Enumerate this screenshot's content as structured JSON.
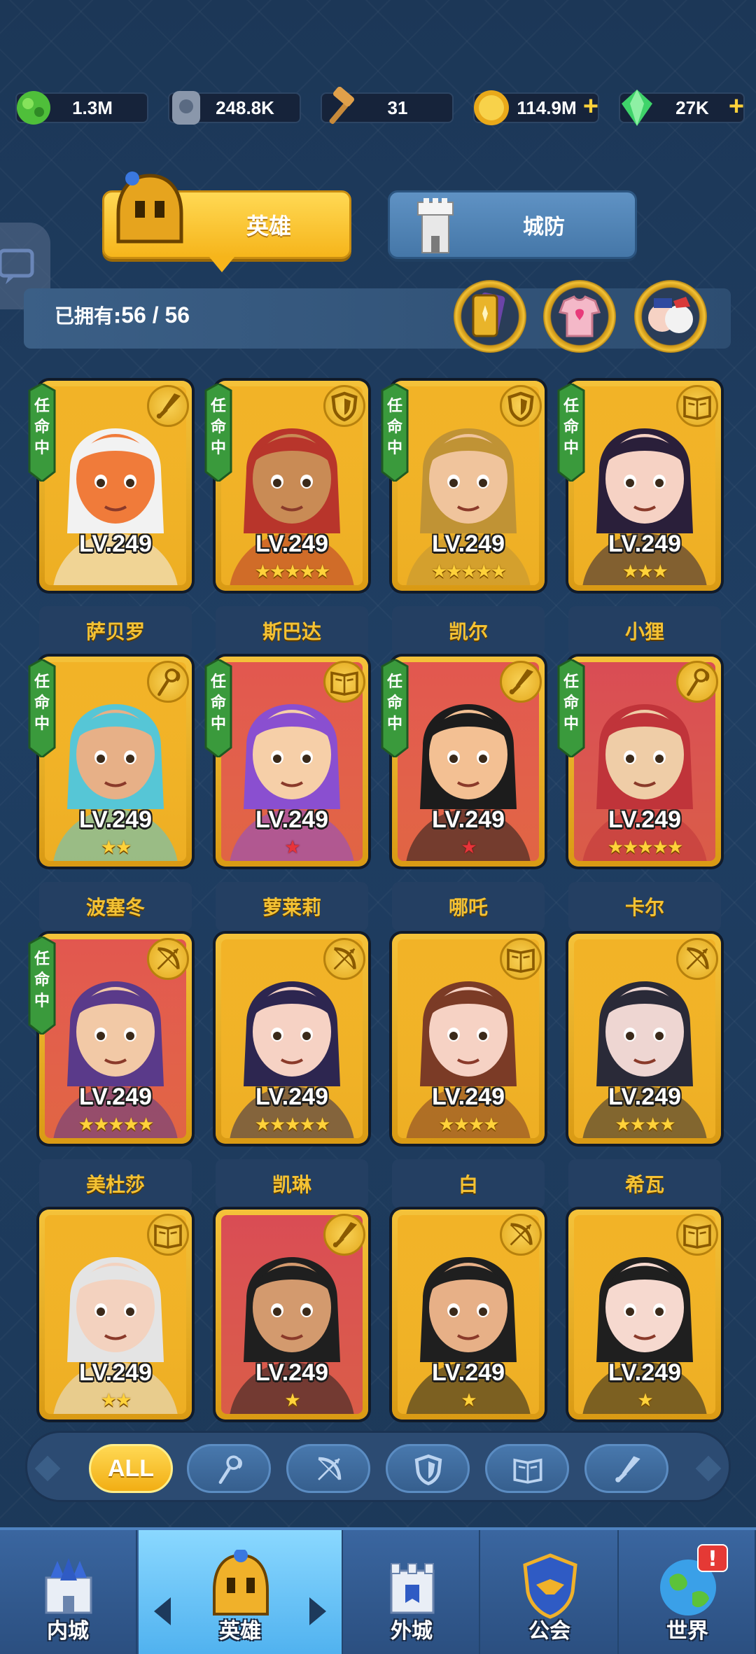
{
  "resources": [
    {
      "name": "food",
      "icon": "green-ore-icon",
      "value": "1.3M",
      "plus": false
    },
    {
      "name": "stone",
      "icon": "stone-icon",
      "value": "248.8K",
      "plus": false
    },
    {
      "name": "hammer",
      "icon": "hammer-icon",
      "value": "31",
      "plus": false
    },
    {
      "name": "gold",
      "icon": "gold-coin-icon",
      "value": "114.9M",
      "plus": true
    },
    {
      "name": "gem",
      "icon": "green-gem-icon",
      "value": "27K",
      "plus": true
    }
  ],
  "tabs": {
    "heroes": "英雄",
    "defense": "城防"
  },
  "owned": {
    "label": "已拥有:",
    "count": "56 / 56"
  },
  "heroes": [
    {
      "name": "萨贝罗",
      "level": "LV.249",
      "stars": 0,
      "star_color": "gold",
      "assigned": true,
      "class_icon": "sword-icon",
      "bg": "#f2b327",
      "skin": "#f07b3a",
      "hair": "#f2f2f2"
    },
    {
      "name": "斯巴达",
      "level": "LV.249",
      "stars": 5,
      "star_color": "gold",
      "assigned": true,
      "class_icon": "shield-icon",
      "bg": "#f2b327",
      "skin": "#c98b55",
      "hair": "#b8352b"
    },
    {
      "name": "凯尔",
      "level": "LV.249",
      "stars": 5,
      "star_color": "gold",
      "assigned": true,
      "class_icon": "shield-icon",
      "bg": "#f2b327",
      "skin": "#f0c49c",
      "hair": "#c09335"
    },
    {
      "name": "小狸",
      "level": "LV.249",
      "stars": 3,
      "star_color": "gold",
      "assigned": true,
      "class_icon": "book-icon",
      "bg": "#f2b327",
      "skin": "#f6d2c4",
      "hair": "#2a1f3a"
    },
    {
      "name": "波塞冬",
      "level": "LV.249",
      "stars": 2,
      "star_color": "gold",
      "assigned": true,
      "class_icon": "staff-icon",
      "bg": "#f2b327",
      "skin": "#e7b087",
      "hair": "#56c6d6"
    },
    {
      "name": "萝莱莉",
      "level": "LV.249",
      "stars": 1,
      "star_color": "red",
      "assigned": true,
      "class_icon": "book-icon",
      "bg": "#e2574f",
      "skin": "#f6cfa8",
      "hair": "#8a4fd0"
    },
    {
      "name": "哪吒",
      "level": "LV.249",
      "stars": 1,
      "star_color": "red",
      "assigned": true,
      "class_icon": "sword-icon",
      "bg": "#e2574f",
      "skin": "#f3c093",
      "hair": "#1c1c1c"
    },
    {
      "name": "卡尔",
      "level": "LV.249",
      "stars": 5,
      "star_color": "gold",
      "assigned": true,
      "class_icon": "staff-icon",
      "bg": "#d94c54",
      "skin": "#efcda7",
      "hair": "#c0343a"
    },
    {
      "name": "美杜莎",
      "level": "LV.249",
      "stars": 5,
      "star_color": "gold",
      "assigned": true,
      "class_icon": "bow-icon",
      "bg": "#e2574f",
      "skin": "#f2c9a6",
      "hair": "#5a3a8a"
    },
    {
      "name": "凯琳",
      "level": "LV.249",
      "stars": 5,
      "star_color": "gold",
      "assigned": false,
      "class_icon": "bow-icon",
      "bg": "#f2b327",
      "skin": "#f6d2c4",
      "hair": "#2d2650"
    },
    {
      "name": "白",
      "level": "LV.249",
      "stars": 4,
      "star_color": "gold",
      "assigned": false,
      "class_icon": "book-icon",
      "bg": "#f2b327",
      "skin": "#f6d2c4",
      "hair": "#7b3b26"
    },
    {
      "name": "希瓦",
      "level": "LV.249",
      "stars": 4,
      "star_color": "gold",
      "assigned": false,
      "class_icon": "bow-icon",
      "bg": "#f2b327",
      "skin": "#eed6d2",
      "hair": "#2a2a38"
    },
    {
      "name": "",
      "level": "LV.249",
      "stars": 2,
      "star_color": "gold",
      "assigned": false,
      "class_icon": "book-icon",
      "bg": "#f2b327",
      "skin": "#f3d2bf",
      "hair": "#e4e4e4"
    },
    {
      "name": "",
      "level": "LV.249",
      "stars": 1,
      "star_color": "gold",
      "assigned": false,
      "class_icon": "sword-icon",
      "bg": "#d94c54",
      "skin": "#d39a6e",
      "hair": "#1f1f1f"
    },
    {
      "name": "",
      "level": "LV.249",
      "stars": 1,
      "star_color": "gold",
      "assigned": false,
      "class_icon": "bow-icon",
      "bg": "#f2b327",
      "skin": "#e7b087",
      "hair": "#1f1f1f"
    },
    {
      "name": "",
      "level": "LV.249",
      "stars": 1,
      "star_color": "gold",
      "assigned": false,
      "class_icon": "book-icon",
      "bg": "#f2b327",
      "skin": "#f6d9cf",
      "hair": "#1f1f1f"
    }
  ],
  "assigned_label": [
    "任",
    "命",
    "中"
  ],
  "filters": [
    {
      "label": "ALL",
      "icon": "",
      "active": true
    },
    {
      "label": "",
      "icon": "staff-icon",
      "active": false
    },
    {
      "label": "",
      "icon": "bow-icon",
      "active": false
    },
    {
      "label": "",
      "icon": "shield-icon",
      "active": false
    },
    {
      "label": "",
      "icon": "book-icon",
      "active": false
    },
    {
      "label": "",
      "icon": "sword-icon",
      "active": false
    }
  ],
  "nav": [
    {
      "label": "内城",
      "icon": "castle-icon",
      "active": false
    },
    {
      "label": "英雄",
      "icon": "helmet-icon",
      "active": true
    },
    {
      "label": "外城",
      "icon": "outer-city-icon",
      "active": false
    },
    {
      "label": "公会",
      "icon": "guild-icon",
      "active": false
    },
    {
      "label": "世界",
      "icon": "globe-icon",
      "active": false,
      "alert": "!"
    }
  ],
  "colors": {
    "gold": "#f4c234",
    "background": "#1d3a5c",
    "ribbon": "#3a9a3c"
  }
}
